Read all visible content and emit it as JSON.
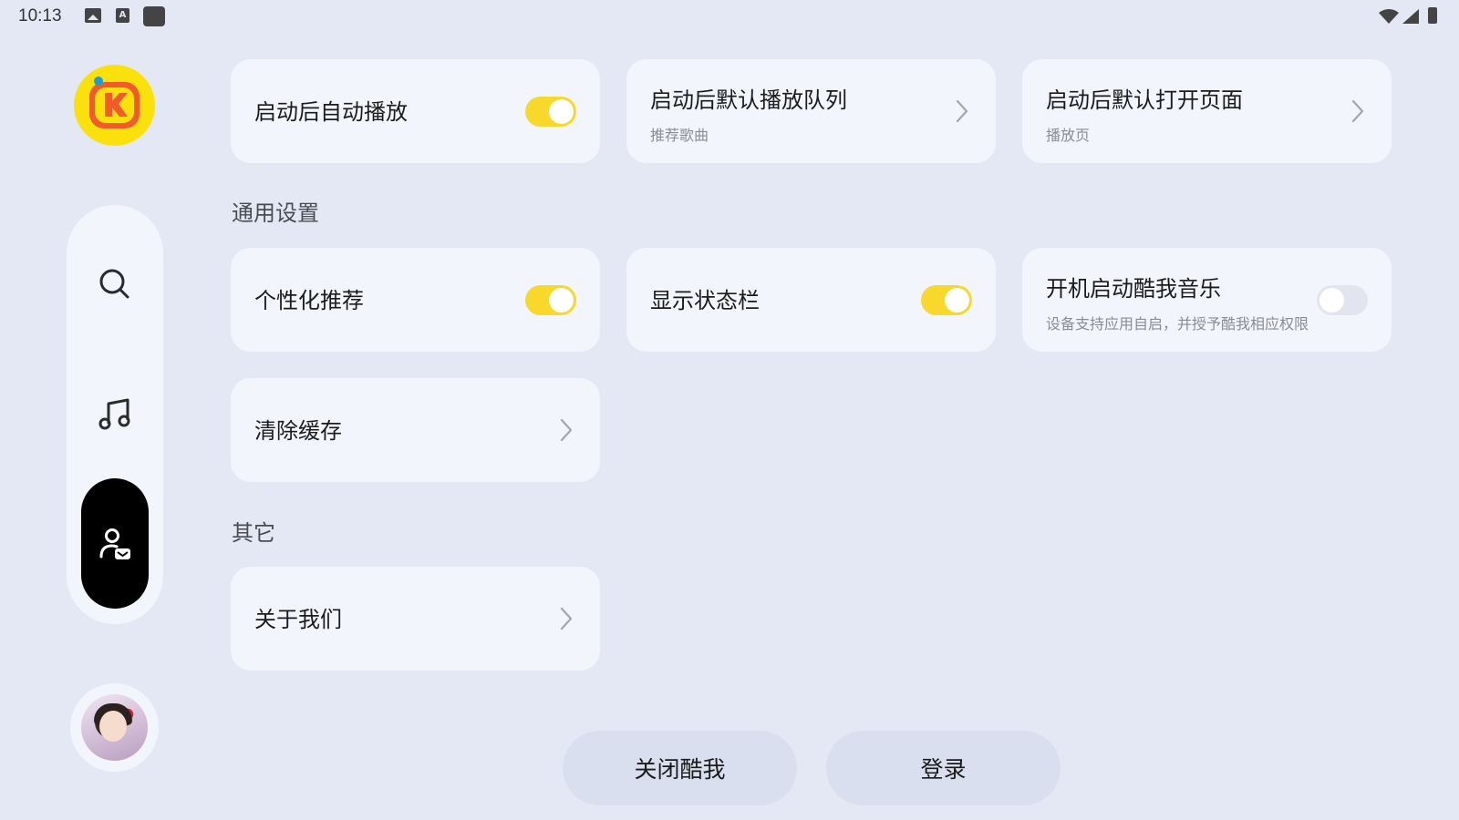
{
  "status_bar": {
    "time": "10:13",
    "icons": [
      "image-icon",
      "a-icon",
      "square-app-icon",
      "wifi-icon",
      "signal-icon",
      "battery-icon"
    ]
  },
  "sidebar": {
    "logo": "kuwo-logo",
    "nav": [
      {
        "name": "search",
        "icon": "search-icon"
      },
      {
        "name": "music",
        "icon": "music-note-icon"
      },
      {
        "name": "profile",
        "icon": "user-profile-icon",
        "active": true
      }
    ],
    "avatar": "user-avatar"
  },
  "startup": {
    "autoplay": {
      "label": "启动后自动播放",
      "on": true
    },
    "default_queue": {
      "label": "启动后默认播放队列",
      "sub": "推荐歌曲"
    },
    "default_page": {
      "label": "启动后默认打开页面",
      "sub": "播放页"
    }
  },
  "general": {
    "title": "通用设置",
    "personalized": {
      "label": "个性化推荐",
      "on": true
    },
    "show_statusbar": {
      "label": "显示状态栏",
      "on": true
    },
    "boot_start": {
      "label": "开机启动酷我音乐",
      "sub": "设备支持应用自启，并授予酷我相应权限",
      "on": false
    },
    "clear_cache": {
      "label": "清除缓存"
    }
  },
  "other": {
    "title": "其它",
    "about": {
      "label": "关于我们"
    }
  },
  "buttons": {
    "close": "关闭酷我",
    "login": "登录"
  },
  "colors": {
    "background": "#e4e8f5",
    "card": "#f3f5fd",
    "toggle_on": "#f8d82a",
    "toggle_off": "#e2e5ef",
    "accent_logo": "#fbe10b",
    "logo_k": "#f25a2b"
  }
}
